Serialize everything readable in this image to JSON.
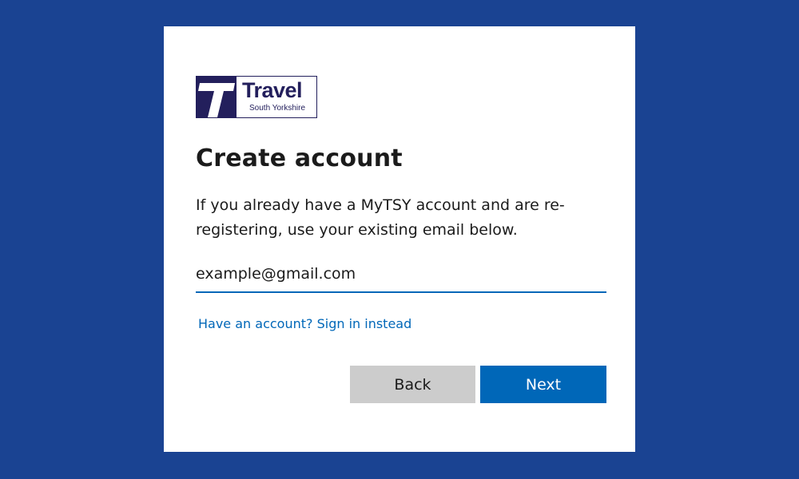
{
  "logo": {
    "wordmark": "Travel",
    "subtitle": "South Yorkshire"
  },
  "form": {
    "title": "Create account",
    "description": "If you already have a MyTSY account and are re-registering, use your existing email below.",
    "email_value": "example@gmail.com",
    "signin_link": "Have an account? Sign in instead"
  },
  "buttons": {
    "back_label": "Back",
    "next_label": "Next"
  },
  "colors": {
    "page_background": "#1a4392",
    "brand_navy": "#231f5c",
    "accent_blue": "#0067b8",
    "secondary_button": "#cccccc"
  }
}
